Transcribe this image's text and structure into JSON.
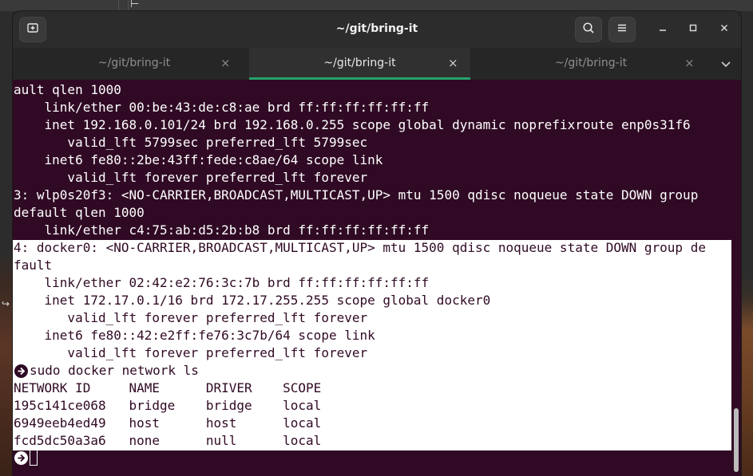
{
  "window": {
    "title": "~/git/bring-it"
  },
  "tabs": [
    {
      "label": "~/git/bring-it",
      "active": false
    },
    {
      "label": "~/git/bring-it",
      "active": true
    },
    {
      "label": "~/git/bring-it",
      "active": false
    }
  ],
  "icons": {
    "new_tab": "new-tab-icon",
    "search": "search-icon",
    "menu": "hamburger-menu-icon",
    "minimize": "minimize-icon",
    "maximize": "maximize-icon",
    "close": "close-icon",
    "tab_close": "×",
    "dropdown": "chevron-down-icon",
    "prompt": "arrow-right-circle-icon"
  },
  "colors": {
    "terminal_bg": "#300a24",
    "terminal_fg": "#ffffff",
    "active_tab_accent": "#26a269",
    "selection_bg": "#ffffff"
  },
  "terminal": {
    "lines": [
      "ault qlen 1000",
      "    link/ether 00:be:43:de:c8:ae brd ff:ff:ff:ff:ff:ff",
      "    inet 192.168.0.101/24 brd 192.168.0.255 scope global dynamic noprefixroute enp0s31f6",
      "       valid_lft 5799sec preferred_lft 5799sec",
      "    inet6 fe80::2be:43ff:fede:c8ae/64 scope link",
      "       valid_lft forever preferred_lft forever",
      "3: wlp0s20f3: <NO-CARRIER,BROADCAST,MULTICAST,UP> mtu 1500 qdisc noqueue state DOWN group",
      "default qlen 1000",
      "    link/ether c4:75:ab:d5:2b:b8 brd ff:ff:ff:ff:ff:ff",
      "4: docker0: <NO-CARRIER,BROADCAST,MULTICAST,UP> mtu 1500 qdisc noqueue state DOWN group de",
      "fault",
      "    link/ether 02:42:e2:76:3c:7b brd ff:ff:ff:ff:ff:ff",
      "    inet 172.17.0.1/16 brd 172.17.255.255 scope global docker0",
      "       valid_lft forever preferred_lft forever",
      "    inet6 fe80::42:e2ff:fe76:3c7b/64 scope link",
      "       valid_lft forever preferred_lft forever",
      "sudo docker network ls",
      "NETWORK ID     NAME      DRIVER    SCOPE",
      "195c141ce068   bridge    bridge    local",
      "6949eeb4ed49   host      host      local",
      "fcd5dc50a3a6   none      null      local"
    ]
  }
}
